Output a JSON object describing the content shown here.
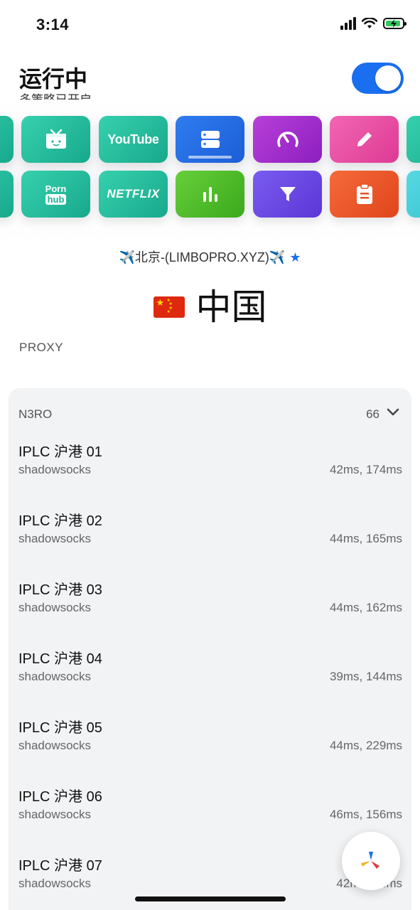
{
  "status_bar": {
    "time": "3:14"
  },
  "header": {
    "title": "运行中",
    "subtitle": "多策略已开启",
    "running": true
  },
  "tiles": {
    "row1": [
      {
        "name": "bilibili-tile",
        "icon": "tv-icon"
      },
      {
        "name": "youtube-tile",
        "label": "YouTube"
      },
      {
        "name": "servers-tile",
        "icon": "server-icon"
      },
      {
        "name": "speedometer-tile",
        "icon": "gauge-icon"
      },
      {
        "name": "edit-tile",
        "icon": "pencil-icon"
      }
    ],
    "row2": [
      {
        "name": "pornhub-tile",
        "label_top": "Porn",
        "label_bottom": "hub"
      },
      {
        "name": "netflix-tile",
        "label": "NETFLIX"
      },
      {
        "name": "stats-tile",
        "icon": "bar-chart-icon"
      },
      {
        "name": "filter-tile",
        "icon": "filter-icon"
      },
      {
        "name": "clipboard-tile",
        "icon": "clipboard-icon"
      }
    ]
  },
  "current": {
    "node": "✈️北京-(LIMBOPRO.XYZ)✈️",
    "country": "中国"
  },
  "section_label": "PROXY",
  "group": {
    "name": "N3RO",
    "count": "66",
    "items": [
      {
        "name": "IPLC 沪港 01",
        "protocol": "shadowsocks",
        "latency": "42ms, 174ms"
      },
      {
        "name": "IPLC 沪港 02",
        "protocol": "shadowsocks",
        "latency": "44ms, 165ms"
      },
      {
        "name": "IPLC 沪港 03",
        "protocol": "shadowsocks",
        "latency": "44ms, 162ms"
      },
      {
        "name": "IPLC 沪港 04",
        "protocol": "shadowsocks",
        "latency": "39ms, 144ms"
      },
      {
        "name": "IPLC 沪港 05",
        "protocol": "shadowsocks",
        "latency": "44ms, 229ms"
      },
      {
        "name": "IPLC 沪港 06",
        "protocol": "shadowsocks",
        "latency": "46ms, 156ms"
      },
      {
        "name": "IPLC 沪港 07",
        "protocol": "shadowsocks",
        "latency": "42ms, 1..ms"
      }
    ]
  },
  "colors": {
    "accent": "#1a6ff0",
    "card_bg": "#f2f3f5"
  }
}
